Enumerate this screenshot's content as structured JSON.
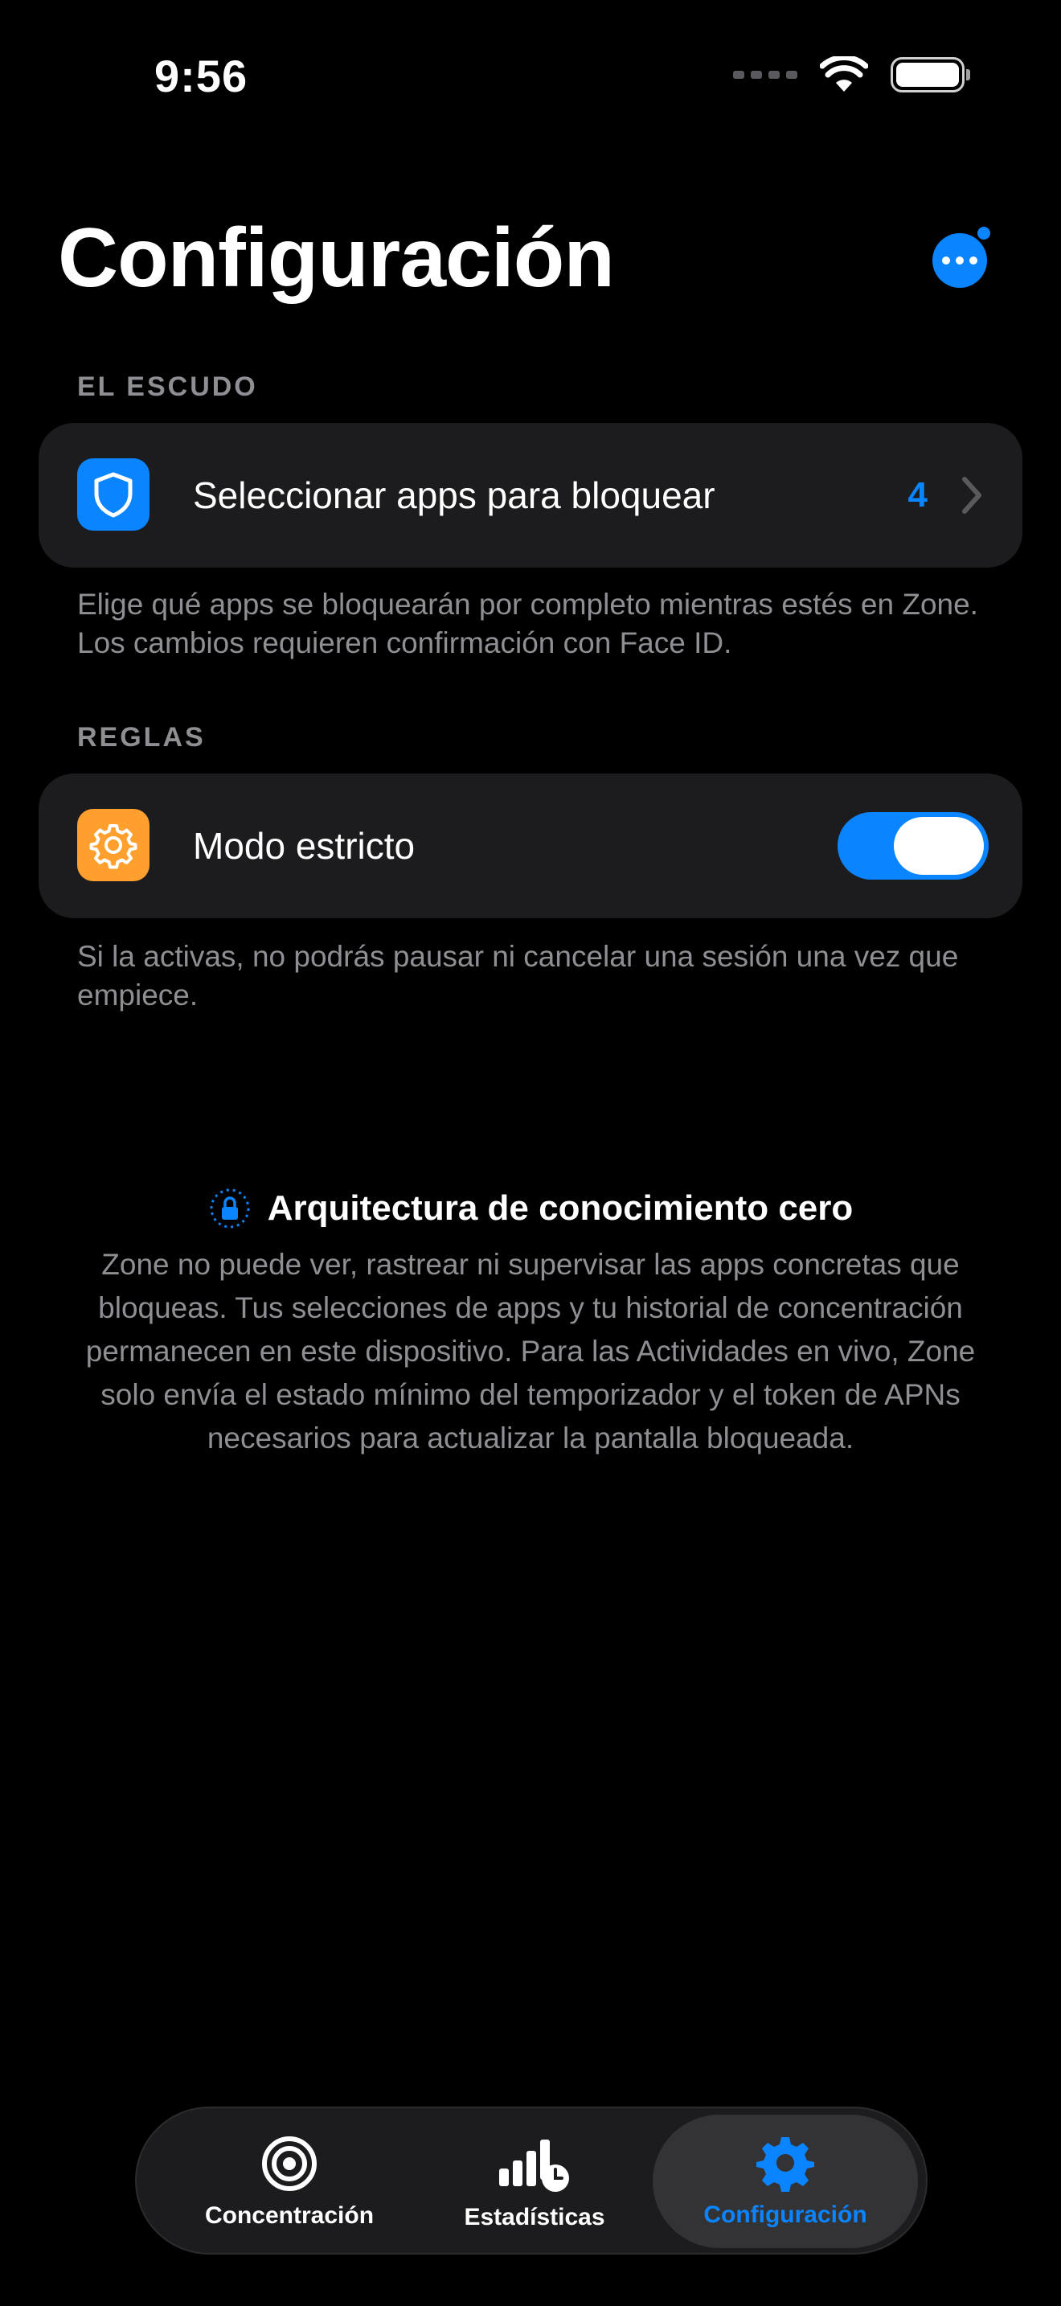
{
  "status_bar": {
    "time": "9:56"
  },
  "header": {
    "title": "Configuración"
  },
  "shield_section": {
    "header": "EL ESCUDO",
    "row_label": "Seleccionar apps para bloquear",
    "count": "4",
    "footer": "Elige qué apps se bloquearán por completo mientras estés en Zone. Los cambios requieren confirmación con Face ID."
  },
  "rules_section": {
    "header": "REGLAS",
    "row_label": "Modo estricto",
    "toggle_on": true,
    "footer": "Si la activas, no podrás pausar ni cancelar una sesión una vez que empiece."
  },
  "privacy": {
    "title": "Arquitectura de conocimiento cero",
    "body": "Zone no puede ver, rastrear ni supervisar las apps concretas que bloqueas. Tus selecciones de apps y tu historial de concentración permanecen en este dispositivo. Para las Actividades en vivo, Zone solo envía el estado mínimo del temporizador y el token de APNs necesarios para actualizar la pantalla bloqueada."
  },
  "tabs": [
    {
      "label": "Concentración",
      "icon": "target-icon"
    },
    {
      "label": "Estadísticas",
      "icon": "stats-clock-icon"
    },
    {
      "label": "Configuración",
      "icon": "gear-icon",
      "active": true
    }
  ],
  "colors": {
    "accent": "#0a84ff",
    "orange": "#ff9f2e",
    "card": "#1c1c1e",
    "secondary_text": "#8e8e93"
  }
}
